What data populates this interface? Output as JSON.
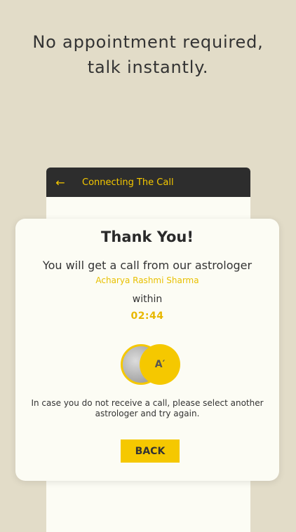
{
  "headline": {
    "line1": "No appointment required,",
    "line2": "talk instantly."
  },
  "appbar": {
    "back_icon": "arrow-left-icon",
    "title": "Connecting The Call"
  },
  "dialog": {
    "title": "Thank You!",
    "message": "You will get a call from our astrologer",
    "astrologer_name": "Acharya Rashmi Sharma",
    "within_label": "within",
    "countdown": "02:44",
    "astrologer_logo": "A′",
    "info": "In case you do not receive a call, please select another astrologer and try again.",
    "back_label": "BACK"
  },
  "colors": {
    "accent": "#f5c800",
    "background": "#e2dcc8",
    "appbar": "#2d2d2d",
    "card": "#fcfcf4"
  }
}
